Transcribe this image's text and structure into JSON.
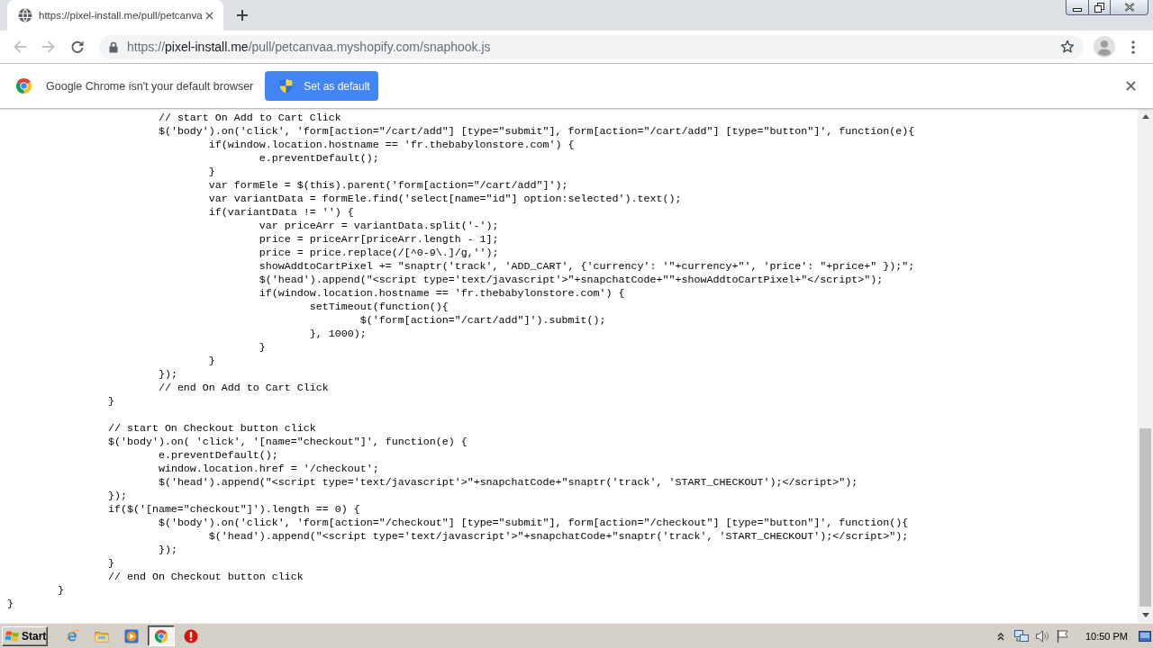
{
  "tabs": [
    {
      "title": "https://pixel-install.me/pull/petcanva",
      "selected": true
    }
  ],
  "toolbar": {
    "nav_buttons": [
      {
        "kind": "back",
        "disabled": true
      },
      {
        "kind": "forward",
        "disabled": true
      },
      {
        "kind": "reload",
        "disabled": false
      }
    ],
    "url": {
      "scheme": "https://",
      "host": "pixel-install.me",
      "path": "/pull/petcanvaa.myshopify.com/snaphook.js"
    }
  },
  "infobar": {
    "message": "Google Chrome isn't your default browser",
    "button": "Set as default"
  },
  "code_blocks": [
    [
      "\t\t\t// start On Add to Cart Click",
      "\t\t\t$('body').on('click', 'form[action=\"/cart/add\"] [type=\"submit\"], form[action=\"/cart/add\"] [type=\"button\"]', function(e){",
      "\t\t\t\tif(window.location.hostname == 'fr.thebabylonstore.com') {",
      "\t\t\t\t\te.preventDefault();",
      "\t\t\t\t}",
      "\t\t\t\tvar formEle = $(this).parent('form[action=\"/cart/add\"]');",
      "\t\t\t\tvar variantData = formEle.find('select[name=\"id\"] option:selected').text();",
      "\t\t\t\tif(variantData != '') {",
      "\t\t\t\t\tvar priceArr = variantData.split('-');",
      "\t\t\t\t\tprice = priceArr[priceArr.length - 1];",
      "\t\t\t\t\tprice = price.replace(/[^0-9\\.]/g,'');",
      "\t\t\t\t\tshowAddtoCartPixel += \"snaptr('track', 'ADD_CART', {'currency': '\"+currency+\"', 'price': \"+price+\" });\";",
      "\t\t\t\t\t$('head').append(\"<script type='text/javascript'>\"+snapchatCode+\"\"+showAddtoCartPixel+\"</script>\");",
      "\t\t\t\t\tif(window.location.hostname == 'fr.thebabylonstore.com') {",
      "\t\t\t\t\t\tsetTimeout(function(){",
      "\t\t\t\t\t\t\t$('form[action=\"/cart/add\"]').submit();",
      "\t\t\t\t\t\t}, 1000);",
      "\t\t\t\t\t}",
      "\t\t\t\t}",
      "\t\t\t});",
      "\t\t\t// end On Add to Cart Click",
      "\t\t}"
    ],
    [
      "\t\t// start On Checkout button click",
      "\t\t$('body').on( 'click', '[name=\"checkout\"]', function(e) {",
      "\t\t\te.preventDefault();",
      "\t\t\twindow.location.href = '/checkout';",
      "\t\t\t$('head').append(\"<script type='text/javascript'>\"+snapchatCode+\"snaptr('track', 'START_CHECKOUT');</script>\");",
      "\t\t});",
      "\t\tif($('[name=\"checkout\"]').length == 0) {",
      "\t\t\t$('body').on('click', 'form[action=\"/checkout\"] [type=\"submit\"], form[action=\"/checkout\"] [type=\"button\"]', function(){",
      "\t\t\t\t$('head').append(\"<script type='text/javascript'>\"+snapchatCode+\"snaptr('track', 'START_CHECKOUT');</script>\");",
      "\t\t\t});",
      "\t\t}",
      "\t\t// end On Checkout button click",
      "\t}",
      "}"
    ]
  ],
  "taskbar": {
    "start": "Start",
    "apps": [
      {
        "kind": "ie",
        "selected": false
      },
      {
        "kind": "files",
        "selected": false
      },
      {
        "kind": "media",
        "selected": false
      },
      {
        "kind": "chrome",
        "selected": true
      },
      {
        "kind": "stop",
        "selected": false
      }
    ],
    "clock": "10:50 PM"
  }
}
